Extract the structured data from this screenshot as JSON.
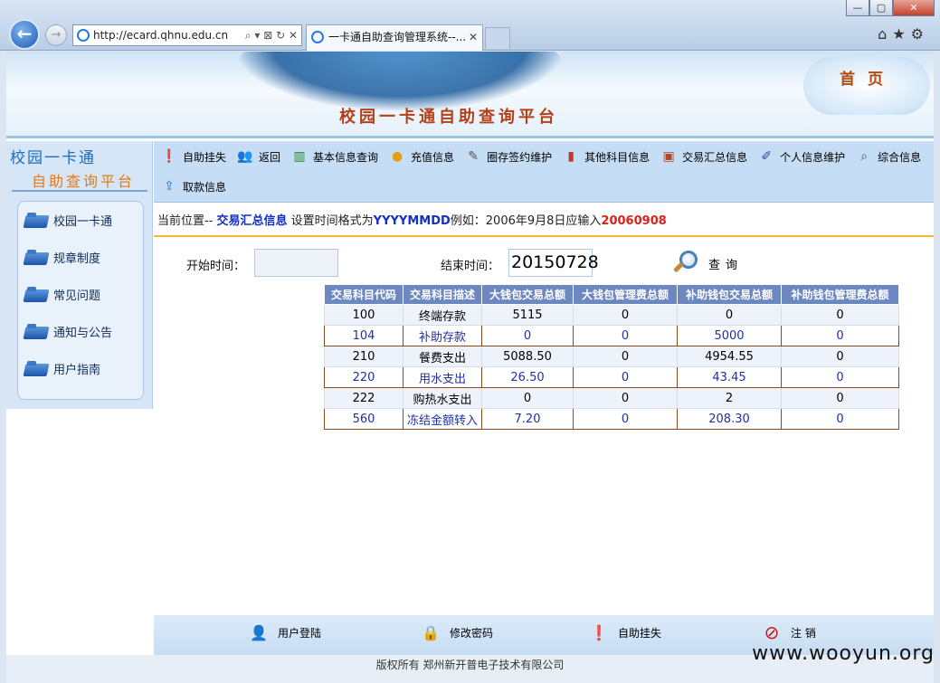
{
  "browser": {
    "address": "http://ecard.qhnu.edu.cn",
    "address_tools": "⌕ ▾ ⊠ ↻ ✕",
    "tab_title": "一卡通自助查询管理系统--...",
    "tab_close": "✕"
  },
  "header": {
    "site_title": "校园一卡通自助查询平台",
    "home_link": "首 页"
  },
  "sidebar": {
    "title_line1": "校园一卡通",
    "title_line2": "自助查询平台",
    "items": [
      {
        "label": "校园一卡通"
      },
      {
        "label": "规章制度"
      },
      {
        "label": "常见问题"
      },
      {
        "label": "通知与公告"
      },
      {
        "label": "用户指南"
      }
    ]
  },
  "toolbar": {
    "row1": [
      {
        "label": "自助挂失",
        "icon": "alert-icon"
      },
      {
        "label": "返回",
        "icon": "users-icon"
      },
      {
        "label": "基本信息查询",
        "icon": "chart-icon"
      },
      {
        "label": "充值信息",
        "icon": "coins-icon"
      },
      {
        "label": "圈存签约维护",
        "icon": "pen-icon"
      },
      {
        "label": "其他科目信息",
        "icon": "bar-chart-icon"
      },
      {
        "label": "交易汇总信息",
        "icon": "box-icon"
      },
      {
        "label": "个人信息维护",
        "icon": "edit-icon"
      },
      {
        "label": "综合信息",
        "icon": "search-icon"
      }
    ],
    "row2": [
      {
        "label": "取款信息",
        "icon": "withdraw-icon"
      }
    ]
  },
  "location": {
    "prefix": "当前位置-- ",
    "current": "交易汇总信息",
    "hint_1": " 设置时间格式为",
    "format": "YYYYMMDD",
    "hint_2": "例如：2006年9月8日应输入",
    "example": "20060908"
  },
  "form": {
    "start_label": "开始时间：",
    "start_value": "",
    "end_label": "结束时间：",
    "end_value": "20150728",
    "search_label": "查询"
  },
  "table": {
    "headers": [
      "交易科目代码",
      "交易科目描述",
      "大钱包交易总额",
      "大钱包管理费总额",
      "补助钱包交易总额",
      "补助钱包管理费总额"
    ],
    "rows": [
      [
        "100",
        "终端存款",
        "5115",
        "0",
        "0",
        "0"
      ],
      [
        "104",
        "补助存款",
        "0",
        "0",
        "5000",
        "0"
      ],
      [
        "210",
        "餐费支出",
        "5088.50",
        "0",
        "4954.55",
        "0"
      ],
      [
        "220",
        "用水支出",
        "26.50",
        "0",
        "43.45",
        "0"
      ],
      [
        "222",
        "购热水支出",
        "0",
        "0",
        "2",
        "0"
      ],
      [
        "560",
        "冻结金额转入",
        "7.20",
        "0",
        "208.30",
        "0"
      ]
    ]
  },
  "bottom_nav": [
    {
      "label": "用户登陆",
      "icon": "user-icon"
    },
    {
      "label": "修改密码",
      "icon": "lock-icon"
    },
    {
      "label": "自助挂失",
      "icon": "alert-icon"
    },
    {
      "label": "注 销",
      "icon": "no-entry-icon"
    }
  ],
  "footer": {
    "copyright": "版权所有 郑州新开普电子技术有限公司",
    "watermark": "www.wooyun.org"
  },
  "colors": {
    "header_title": "#b4401a",
    "table_header_bg": "#6d88c0",
    "highlight_blue": "#1330c6",
    "highlight_red": "#e0201a",
    "divider_gold": "#f0b830"
  }
}
